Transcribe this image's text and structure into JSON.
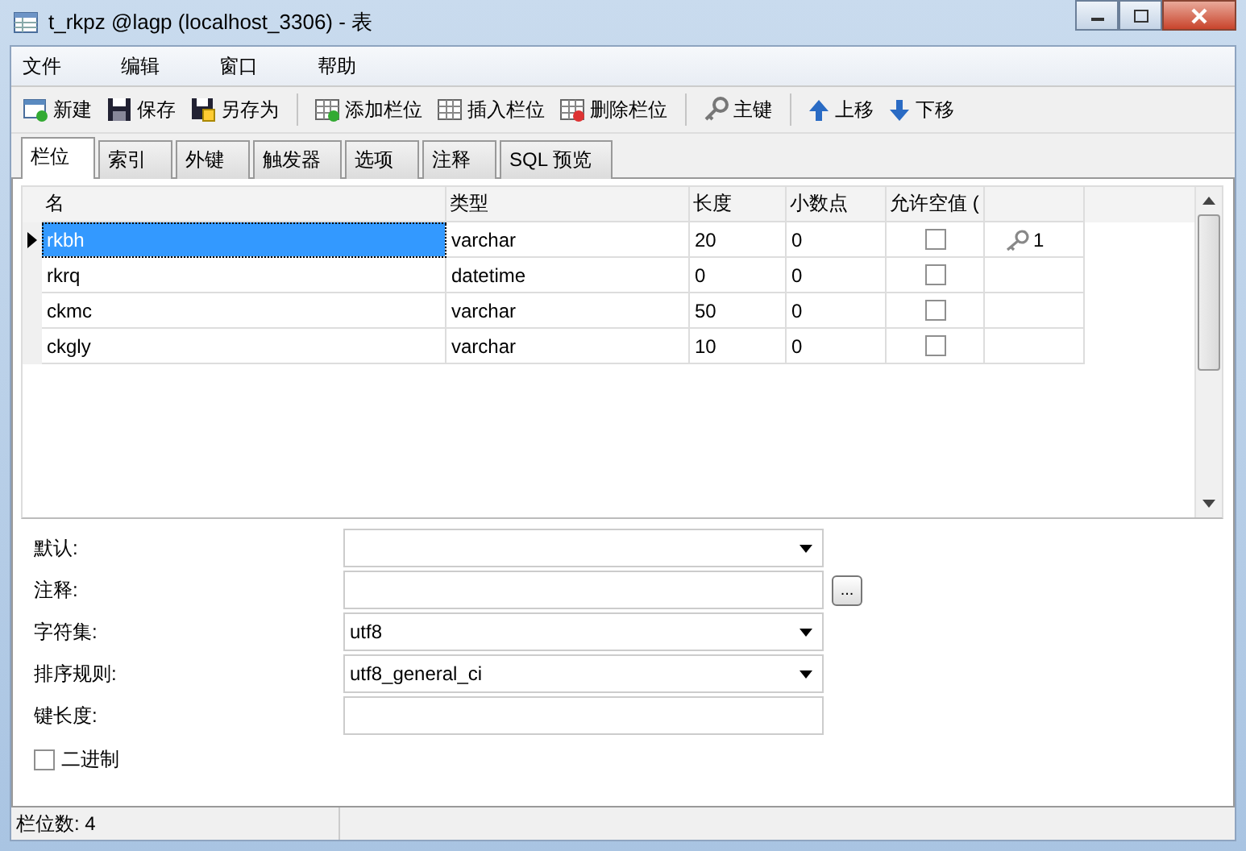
{
  "window": {
    "title": "t_rkpz @lagp (localhost_3306) - 表"
  },
  "menu": [
    "文件",
    "编辑",
    "窗口",
    "帮助"
  ],
  "toolbar": [
    {
      "kind": "new",
      "label": "新建"
    },
    {
      "kind": "save",
      "label": "保存"
    },
    {
      "kind": "saveas",
      "label": "另存为"
    },
    {
      "kind": "sep"
    },
    {
      "kind": "addcol",
      "label": "添加栏位"
    },
    {
      "kind": "inscol",
      "label": "插入栏位"
    },
    {
      "kind": "delcol",
      "label": "删除栏位"
    },
    {
      "kind": "sep"
    },
    {
      "kind": "key",
      "label": "主键"
    },
    {
      "kind": "sep"
    },
    {
      "kind": "up",
      "label": "上移"
    },
    {
      "kind": "down",
      "label": "下移"
    }
  ],
  "tabs": [
    {
      "label": "栏位",
      "selected": true
    },
    {
      "label": "索引",
      "selected": false
    },
    {
      "label": "外键",
      "selected": false
    },
    {
      "label": "触发器",
      "selected": false
    },
    {
      "label": "选项",
      "selected": false
    },
    {
      "label": "注释",
      "selected": false
    },
    {
      "label": "SQL 预览",
      "selected": false
    }
  ],
  "table": {
    "columns": [
      "名",
      "类型",
      "长度",
      "小数点",
      "允许空值 ("
    ],
    "rows": [
      {
        "name": "rkbh",
        "type": "varchar",
        "length": "20",
        "decimals": "0",
        "allow_null": false,
        "key": "1",
        "selected": true
      },
      {
        "name": "rkrq",
        "type": "datetime",
        "length": "0",
        "decimals": "0",
        "allow_null": false,
        "selected": false
      },
      {
        "name": "ckmc",
        "type": "varchar",
        "length": "50",
        "decimals": "0",
        "allow_null": false,
        "selected": false
      },
      {
        "name": "ckgly",
        "type": "varchar",
        "length": "10",
        "decimals": "0",
        "allow_null": false,
        "selected": false
      }
    ]
  },
  "properties": [
    {
      "label": "默认:",
      "kind": "dropdown"
    },
    {
      "label": "注释:",
      "kind": "text_button",
      "button": "..."
    },
    {
      "label": "字符集:",
      "kind": "dropdown",
      "value": "utf8"
    },
    {
      "label": "排序规则:",
      "kind": "dropdown",
      "value": "utf8_general_ci"
    },
    {
      "label": "键长度:",
      "kind": "text"
    }
  ],
  "binary": {
    "label": "二进制",
    "checked": false
  },
  "status_bar": "栏位数: 4"
}
